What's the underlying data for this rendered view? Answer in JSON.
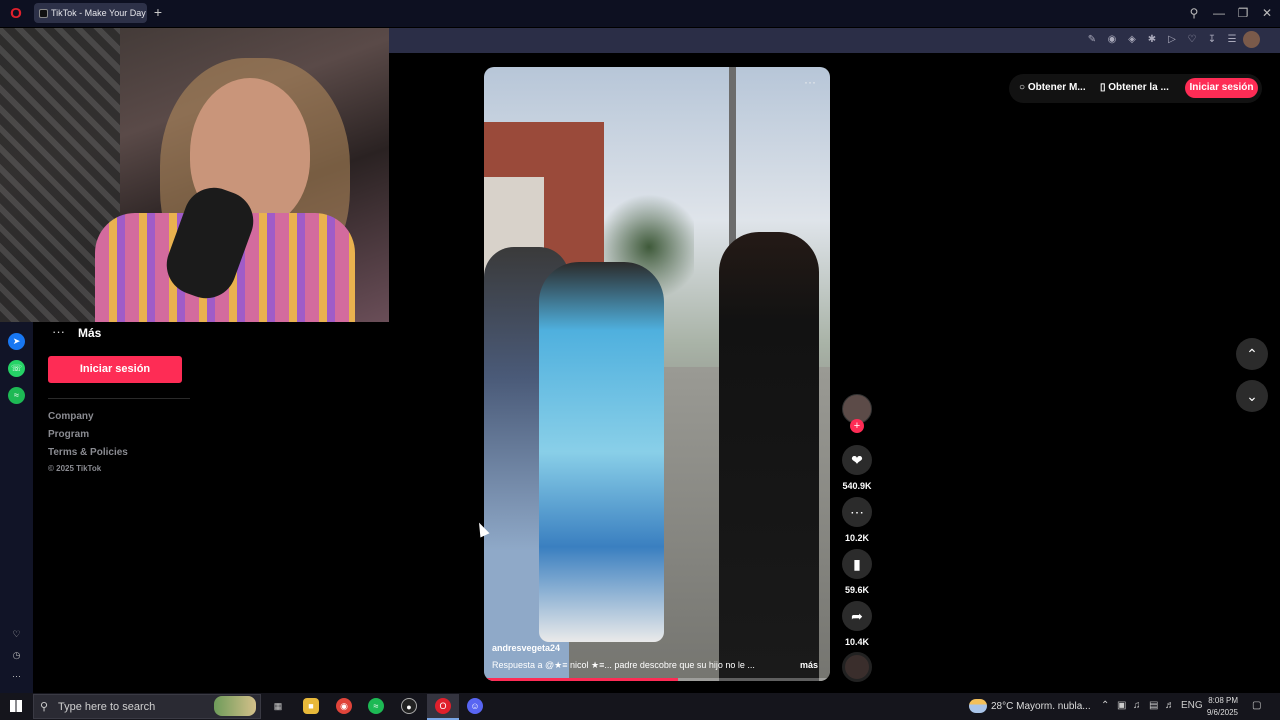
{
  "browser": {
    "tab_title": "TikTok - Make Your Day",
    "new_tab_symbol": "+",
    "logo_letter": "O"
  },
  "sidebar_menu": {
    "more_dots": "···",
    "more_label": "Más",
    "login_button": "Iniciar sesión",
    "footer_links": [
      "Company",
      "Program",
      "Terms & Policies"
    ],
    "copyright": "© 2025 TikTok"
  },
  "top_buttons": {
    "get_app1": "Obtener M...",
    "get_app2": "Obtener la ...",
    "login": "Iniciar sesión"
  },
  "video": {
    "more_dots": "···",
    "author": "andresvegeta24",
    "caption": "Respuesta a @★≡ nicol ★≡... padre descobre que su hijo no le ...",
    "more_link": "más",
    "progress_fraction": 0.56
  },
  "actions": {
    "follow_symbol": "+",
    "likes": "540.9K",
    "comments": "10.2K",
    "saves": "59.6K",
    "shares": "10.4K"
  },
  "taskbar": {
    "search_placeholder": "Type here to search",
    "weather": "28°C  Mayorm. nubla...",
    "language": "ENG",
    "time": "8:08 PM",
    "date": "9/6/2025"
  },
  "colors": {
    "tiktok_accent": "#fe2c55",
    "page_bg": "#000000",
    "browser_chrome": "#0d1021"
  },
  "icons": {
    "search": "search-icon",
    "like": "heart-icon",
    "comment": "comment-icon",
    "save": "bookmark-icon",
    "share": "share-icon",
    "up": "chevron-up-icon",
    "down": "chevron-down-icon"
  }
}
